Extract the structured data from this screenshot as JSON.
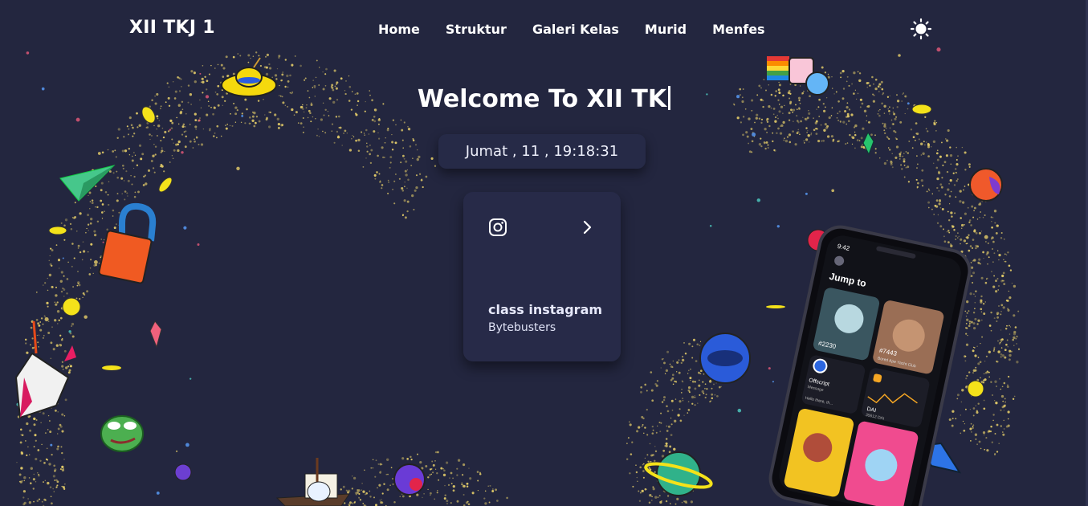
{
  "navbar": {
    "brand": "XII TKJ 1",
    "links": [
      "Home",
      "Struktur",
      "Galeri Kelas",
      "Murid",
      "Menfes"
    ],
    "theme_icon": "sun-icon"
  },
  "hero": {
    "title": "Welcome To XII TK",
    "datetime": "Jumat , 11 , 19:18:31"
  },
  "card": {
    "icon": "instagram-icon",
    "arrow_icon": "chevron-right-icon",
    "title": "class instagram",
    "subtitle": "Bytebusters"
  },
  "phone": {
    "time": "9:42",
    "heading": "Jump to",
    "nft1_label": "#2230",
    "nft2_label": "#7443",
    "nft2_caption": "Bored Ape Yacht Club",
    "app_name": "Offscript",
    "app_sub": "Message",
    "app_preview": "Hello there, th...",
    "token_name": "DAI",
    "token_amount": "35612 DAI"
  },
  "colors": {
    "background": "#23263f",
    "card": "#272a48",
    "text": "#ffffff",
    "sparkle": "#e8d06a"
  }
}
